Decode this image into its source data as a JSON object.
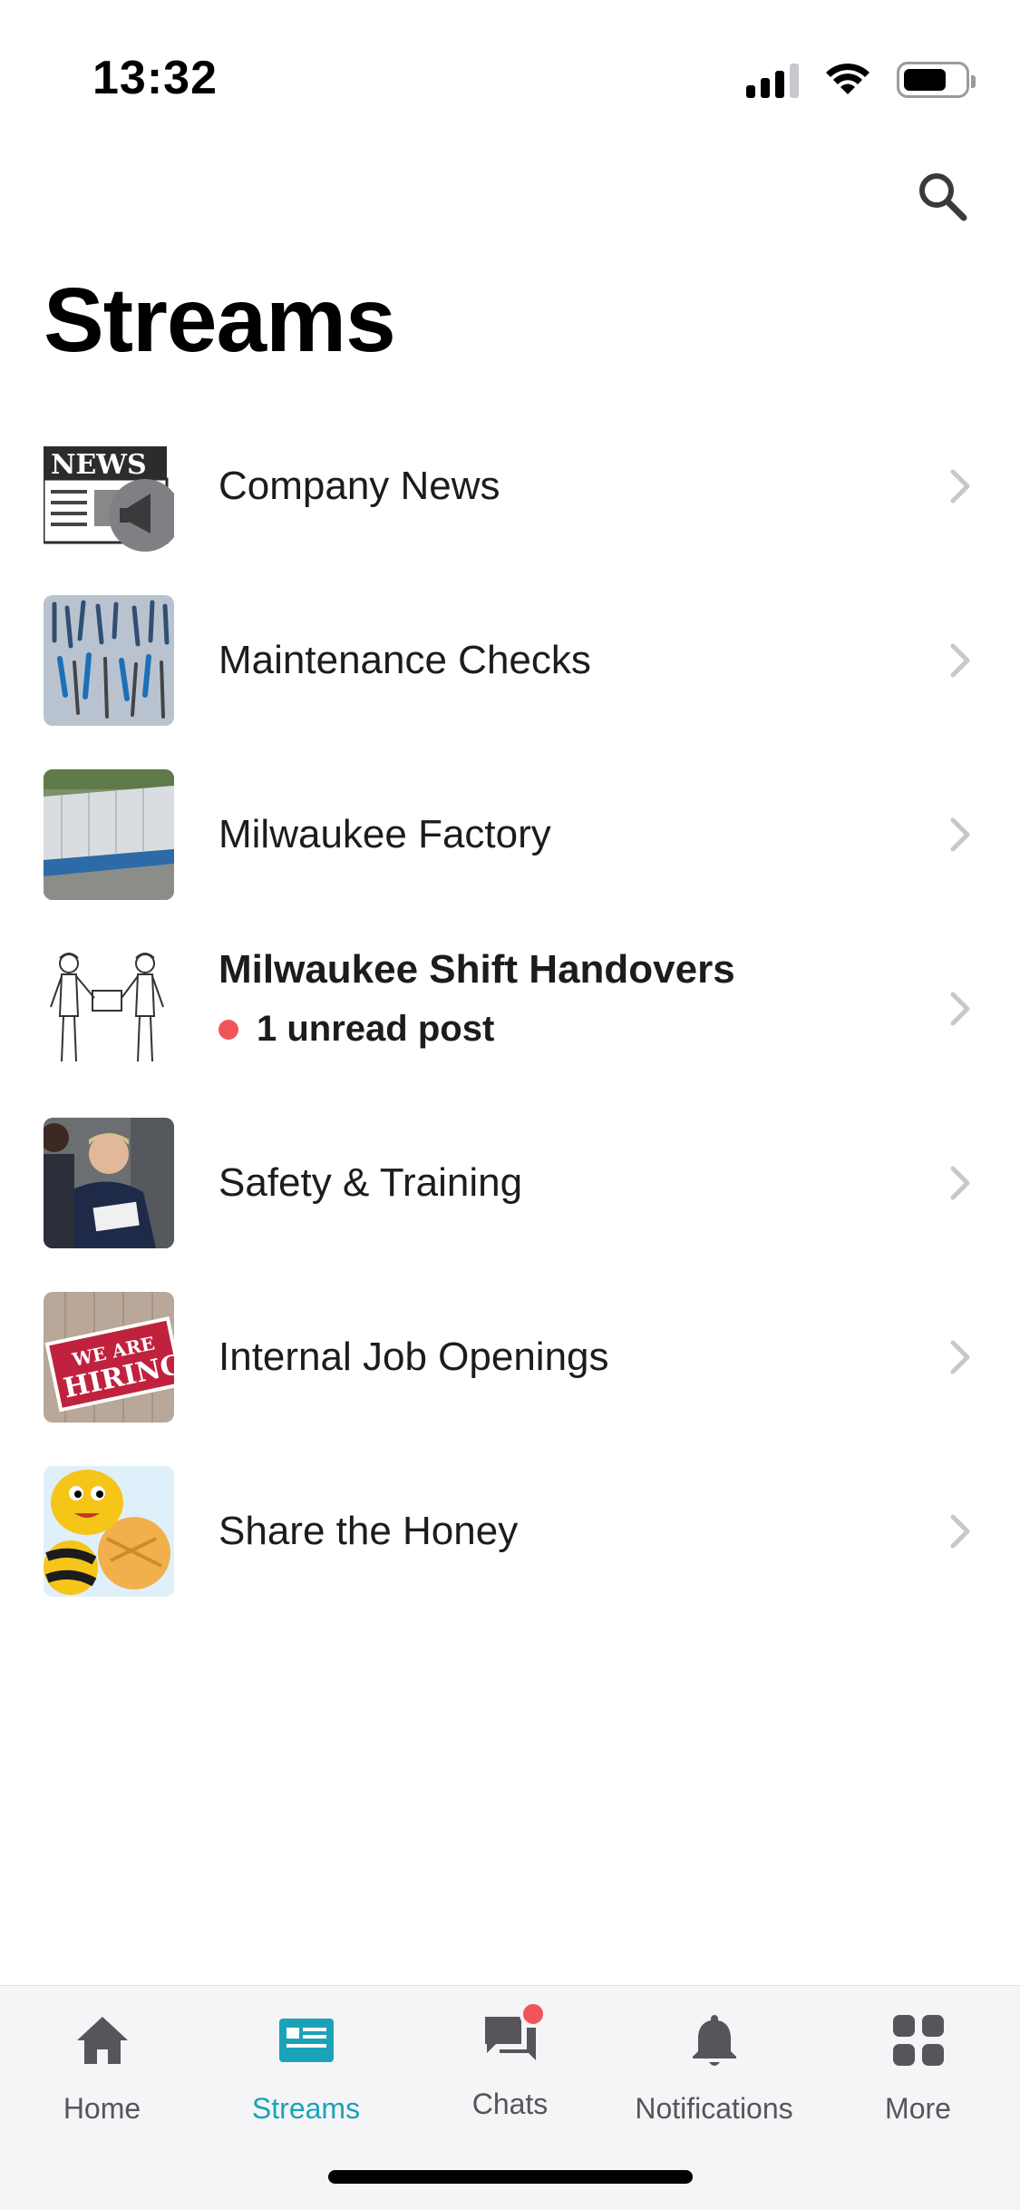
{
  "status_bar": {
    "time": "13:32"
  },
  "header": {
    "title": "Streams",
    "search_icon": "search-icon"
  },
  "streams": [
    {
      "title": "Company News",
      "thumb": "news-megaphone-image"
    },
    {
      "title": "Maintenance Checks",
      "thumb": "tools-image"
    },
    {
      "title": "Milwaukee Factory",
      "thumb": "factory-aerial-image"
    },
    {
      "title": "Milwaukee Shift Handovers",
      "unread": "1 unread post",
      "thumb": "workers-sketch-image"
    },
    {
      "title": "Safety & Training",
      "thumb": "training-photo-image"
    },
    {
      "title": "Internal Job Openings",
      "thumb": "we-are-hiring-sign-image"
    },
    {
      "title": "Share the Honey",
      "thumb": "bee-mascot-image"
    }
  ],
  "tabs": [
    {
      "label": "Home",
      "icon": "home-icon"
    },
    {
      "label": "Streams",
      "icon": "streams-icon",
      "active": true
    },
    {
      "label": "Chats",
      "icon": "chats-icon",
      "badge": true
    },
    {
      "label": "Notifications",
      "icon": "bell-icon"
    },
    {
      "label": "More",
      "icon": "grid-icon"
    }
  ],
  "colors": {
    "accent": "#1aa3b8",
    "badge": "#f2545b",
    "chevron": "#c7c7cc"
  },
  "thumb_text": {
    "news": "NEWS",
    "hiring_line1": "WE ARE",
    "hiring_line2": "HIRING"
  }
}
